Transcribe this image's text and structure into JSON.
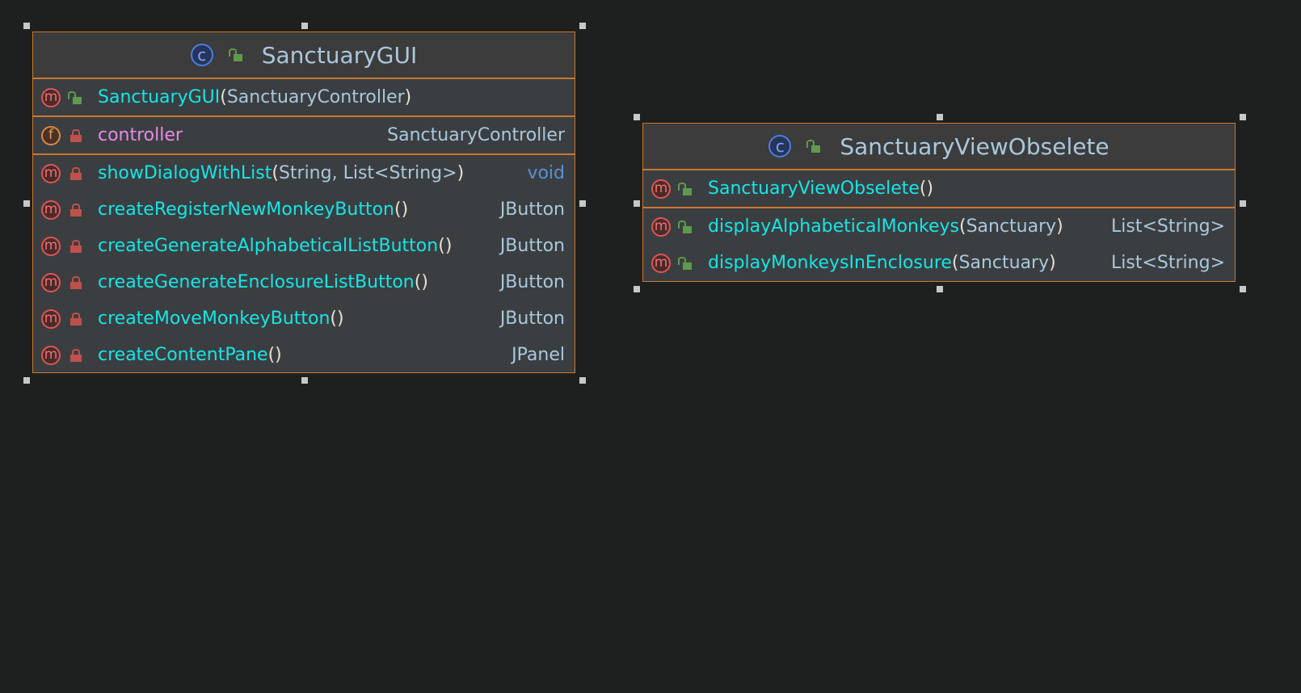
{
  "classes": [
    {
      "name": "SanctuaryGUI",
      "kind_icon": "class-icon",
      "visibility": "public",
      "sections": [
        [
          {
            "kind": "method",
            "visibility": "public",
            "name": "SanctuaryGUI",
            "params": "SanctuaryController",
            "returns": ""
          }
        ],
        [
          {
            "kind": "field",
            "visibility": "private",
            "name": "controller",
            "params": null,
            "returns": "SanctuaryController"
          }
        ],
        [
          {
            "kind": "method",
            "visibility": "private",
            "name": "showDialogWithList",
            "params": "String, List<String>",
            "returns": "void"
          },
          {
            "kind": "method",
            "visibility": "private",
            "name": "createRegisterNewMonkeyButton",
            "params": "",
            "returns": "JButton"
          },
          {
            "kind": "method",
            "visibility": "private",
            "name": "createGenerateAlphabeticalListButton",
            "params": "",
            "returns": "JButton"
          },
          {
            "kind": "method",
            "visibility": "private",
            "name": "createGenerateEnclosureListButton",
            "params": "",
            "returns": "JButton"
          },
          {
            "kind": "method",
            "visibility": "private",
            "name": "createMoveMonkeyButton",
            "params": "",
            "returns": "JButton"
          },
          {
            "kind": "method",
            "visibility": "private",
            "name": "createContentPane",
            "params": "",
            "returns": "JPanel"
          }
        ]
      ]
    },
    {
      "name": "SanctuaryViewObselete",
      "kind_icon": "class-icon",
      "visibility": "public",
      "sections": [
        [
          {
            "kind": "method",
            "visibility": "public",
            "name": "SanctuaryViewObselete",
            "params": "",
            "returns": ""
          }
        ],
        [
          {
            "kind": "method",
            "visibility": "public",
            "name": "displayAlphabeticalMonkeys",
            "params": "Sanctuary",
            "returns": "List<String>"
          },
          {
            "kind": "method",
            "visibility": "public",
            "name": "displayMonkeysInEnclosure",
            "params": "Sanctuary",
            "returns": "List<String>"
          }
        ]
      ]
    }
  ],
  "icons": {
    "method": "m",
    "field": "f",
    "class": "c"
  },
  "colors": {
    "border": "#c8782e",
    "name": "#14e6e6",
    "field": "#e68ae6",
    "void": "#5a8fd8",
    "background": "#1e1f1f"
  }
}
